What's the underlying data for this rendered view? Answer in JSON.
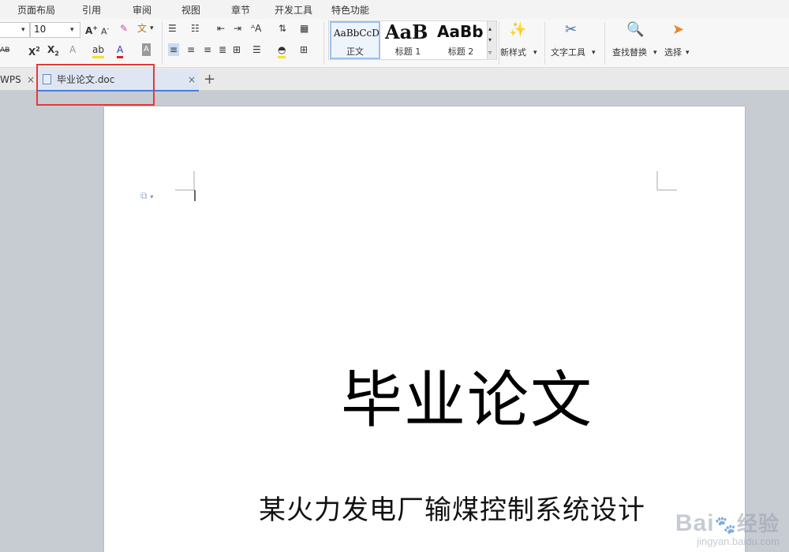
{
  "menu": [
    "页面布局",
    "引用",
    "审阅",
    "视图",
    "章节",
    "开发工具",
    "特色功能"
  ],
  "font_size": "10",
  "styles": [
    {
      "sample": "AaBbCcD",
      "label": "正文"
    },
    {
      "sample": "AaB",
      "label": "标题 1"
    },
    {
      "sample": "AaBb",
      "label": "标题 2"
    }
  ],
  "ribbon_buttons": {
    "new_style": "新样式",
    "text_tools": "文字工具",
    "find_replace": "查找替换",
    "select": "选择"
  },
  "tabs": {
    "wps": "WPS",
    "document": "毕业论文.doc",
    "add": "+"
  },
  "document": {
    "title": "毕业论文",
    "subtitle": "某火力发电厂输煤控制系统设计"
  },
  "watermark": {
    "brand": "Bai",
    "cn": "经验",
    "url": "jingyan.baidu.com"
  }
}
